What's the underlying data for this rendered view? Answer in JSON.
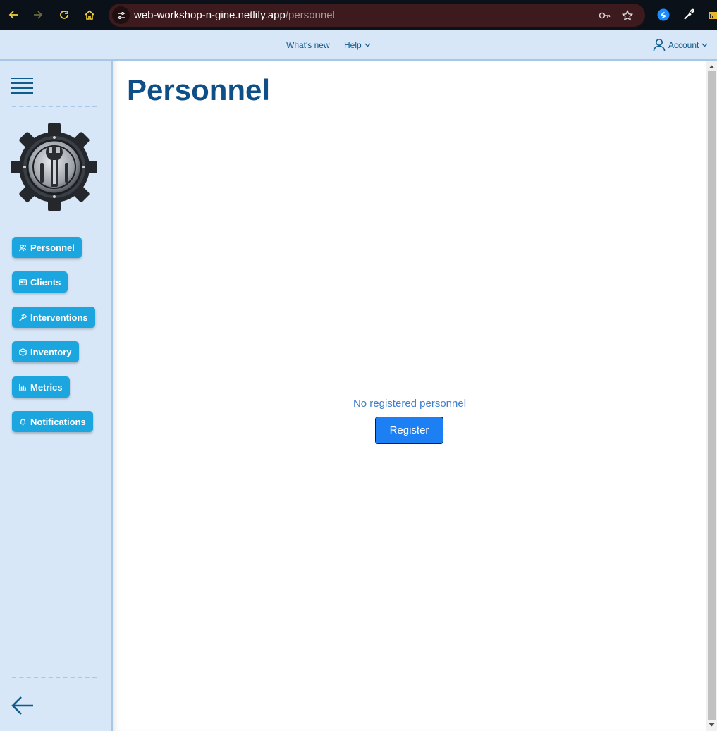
{
  "browser": {
    "url_host": "web-workshop-n-gine.netlify.app",
    "url_path": "/personnel"
  },
  "header": {
    "whats_new": "What's new",
    "help": "Help",
    "account": "Account"
  },
  "sidebar": {
    "items": [
      {
        "label": "Personnel",
        "icon": "people-icon"
      },
      {
        "label": "Clients",
        "icon": "id-card-icon"
      },
      {
        "label": "Interventions",
        "icon": "hammer-icon"
      },
      {
        "label": "Inventory",
        "icon": "box-icon"
      },
      {
        "label": "Metrics",
        "icon": "bar-chart-icon"
      },
      {
        "label": "Notifications",
        "icon": "bell-icon"
      }
    ]
  },
  "main": {
    "title": "Personnel",
    "empty_message": "No registered personnel",
    "register_label": "Register"
  },
  "colors": {
    "sidebar_bg": "#d7e7f8",
    "button_bg": "#1ba6df",
    "title": "#0d4f86",
    "primary": "#1c7ff4"
  }
}
